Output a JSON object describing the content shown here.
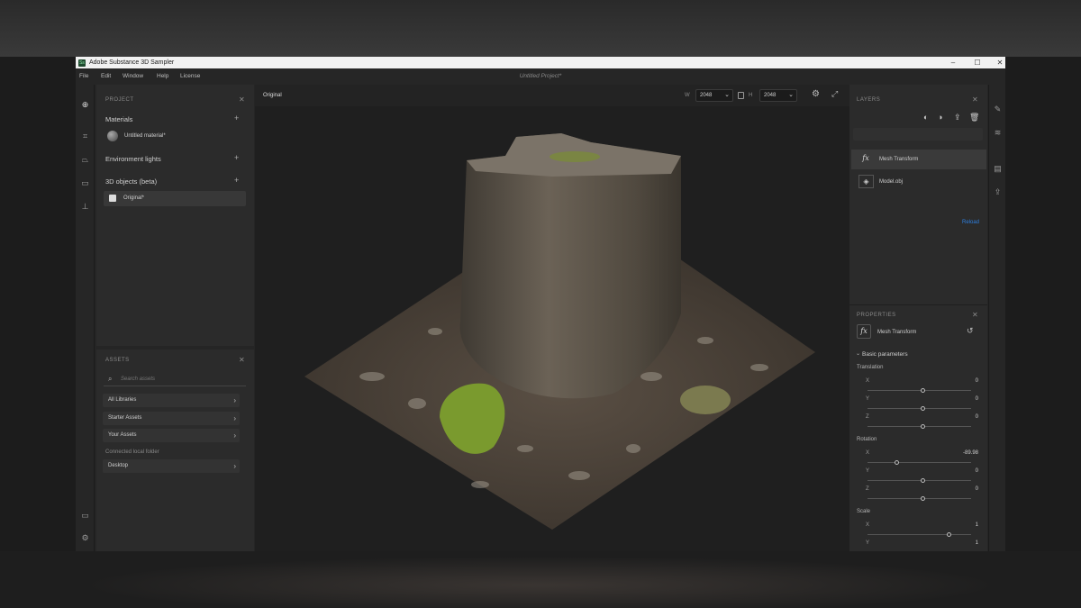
{
  "window": {
    "title": "Adobe Substance 3D Sampler",
    "app_icon_text": "Ss",
    "project_title": "Untitled Project*",
    "controls": [
      "–",
      "☐",
      "✕"
    ]
  },
  "menu": [
    "File",
    "Edit",
    "Window",
    "Help",
    "License"
  ],
  "project_panel": {
    "header": "PROJECT",
    "materials_label": "Materials",
    "material_item": "Untitled material*",
    "env_lights_label": "Environment lights",
    "objects_label": "3D objects (beta)",
    "object_item": "Original*"
  },
  "assets_panel": {
    "header": "ASSETS",
    "search_placeholder": "Search assets",
    "items": [
      "All Libraries",
      "Starter Assets",
      "Your Assets"
    ],
    "connected_label": "Connected local folder",
    "folder_item": "Desktop"
  },
  "viewport": {
    "label": "Original",
    "width_label": "W",
    "width_value": "2048",
    "height_label": "H",
    "height_value": "2048"
  },
  "layers_panel": {
    "header": "LAYERS",
    "layers": [
      {
        "icon": "fx",
        "name": "Mesh Transform"
      },
      {
        "icon": "model",
        "name": "Model.obj"
      }
    ],
    "reload_label": "Reload"
  },
  "properties_panel": {
    "header": "PROPERTIES",
    "title": "Mesh Transform",
    "section": "Basic parameters",
    "translation_label": "Translation",
    "translation": {
      "x": "0",
      "y": "0",
      "z": "0"
    },
    "rotation_label": "Rotation",
    "rotation": {
      "x": "-89.98",
      "y": "0",
      "z": "0"
    },
    "scale_label": "Scale",
    "scale": {
      "x": "1",
      "y": "1"
    }
  },
  "colors": {
    "accent": "#2d7fe0",
    "moss": "#7a9a2e",
    "stump": "#5e5548",
    "ground": "#4a4038"
  }
}
